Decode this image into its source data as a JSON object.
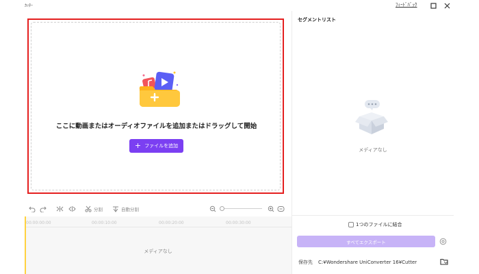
{
  "titlebar": {
    "app_title": "ｶｯﾀｰ",
    "feedback_label": "ﾌｨｰﾄﾞﾊﾞｯｸ",
    "icons": [
      "maximize-icon",
      "close-icon"
    ]
  },
  "dropzone": {
    "instruction": "ここに動画またはオーディオファイルを追加またはドラッグして開始",
    "add_file_label": "ファイルを追加",
    "add_icon": "plus-icon"
  },
  "toolbar": {
    "split_label": "分割",
    "auto_split_label": "自動分割",
    "icons": [
      "undo-icon",
      "redo-icon",
      "split-left-icon",
      "split-right-icon",
      "scissors-icon",
      "auto-split-icon",
      "zoom-out-icon",
      "zoom-in-icon",
      "fit-icon"
    ]
  },
  "timeline": {
    "ticks": [
      "00:00:00:00",
      "00:00:10:00",
      "00:00:20:00",
      "00:00:30:00"
    ],
    "empty_label": "メディアなし"
  },
  "segments": {
    "title": "セグメントリスト",
    "empty_label": "メディアなし"
  },
  "export": {
    "merge_label": "1つのファイルに結合",
    "merge_checked": false,
    "export_all_label": "すべてエクスポート",
    "save_label": "保存先",
    "save_path": "C:¥Wondershare UniConverter 16¥Cutter",
    "icons": [
      "settings-icon",
      "chevron-down-icon",
      "folder-icon"
    ]
  },
  "colors": {
    "accent": "#7b3ff2",
    "accent_disabled": "#c7b3f7",
    "highlight_border": "#e41e1e",
    "playhead": "#ffd23f"
  }
}
